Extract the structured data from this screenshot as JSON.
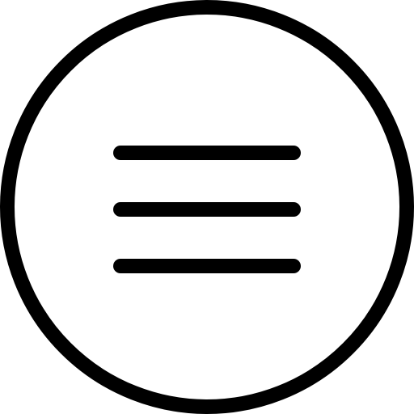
{
  "icon": {
    "name": "menu-circle-icon",
    "stroke_color": "#000000",
    "fill_color": "#ffffff"
  }
}
